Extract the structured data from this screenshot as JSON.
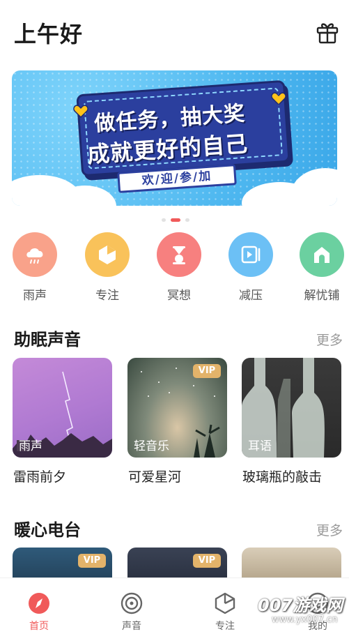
{
  "header": {
    "greeting": "上午好",
    "gift_icon": "gift-icon"
  },
  "banner": {
    "line1": "做任务，抽大奖",
    "line2": "成就更好的自己",
    "tag": "欢/迎/参/加",
    "page_count": 3,
    "active_page": 2
  },
  "categories": [
    {
      "label": "雨声",
      "icon": "cloud-rain-icon",
      "color": "#f9a28a"
    },
    {
      "label": "专注",
      "icon": "focus-pie-icon",
      "color": "#f9c25a"
    },
    {
      "label": "冥想",
      "icon": "hourglass-icon",
      "color": "#f7807f"
    },
    {
      "label": "减压",
      "icon": "play-card-icon",
      "color": "#6cc0f5"
    },
    {
      "label": "解忧铺",
      "icon": "home-icon",
      "color": "#6bd0a0"
    }
  ],
  "sleep_section": {
    "title": "助眠声音",
    "more": "更多",
    "items": [
      {
        "name": "雷雨前夕",
        "tag": "雨声",
        "vip": ""
      },
      {
        "name": "可爱星河",
        "tag": "轻音乐",
        "vip": "VIP"
      },
      {
        "name": "玻璃瓶的敲击",
        "tag": "耳语",
        "vip": ""
      }
    ]
  },
  "radio_section": {
    "title": "暖心电台",
    "more": "更多",
    "items": [
      {
        "vip": "VIP"
      },
      {
        "vip": "VIP"
      },
      {
        "vip": ""
      }
    ]
  },
  "tabs": [
    {
      "label": "首页",
      "icon": "compass-icon",
      "active": true
    },
    {
      "label": "声音",
      "icon": "disc-icon",
      "active": false
    },
    {
      "label": "专注",
      "icon": "focus-pie-icon",
      "active": false
    },
    {
      "label": "我的",
      "icon": "profile-icon",
      "active": false
    }
  ],
  "watermark": {
    "title": "007游戏网",
    "url": "www.yx007.cn"
  },
  "colors": {
    "accent": "#f05a5a",
    "vip": "#e3b36a",
    "banner": "#4fb8f0"
  }
}
